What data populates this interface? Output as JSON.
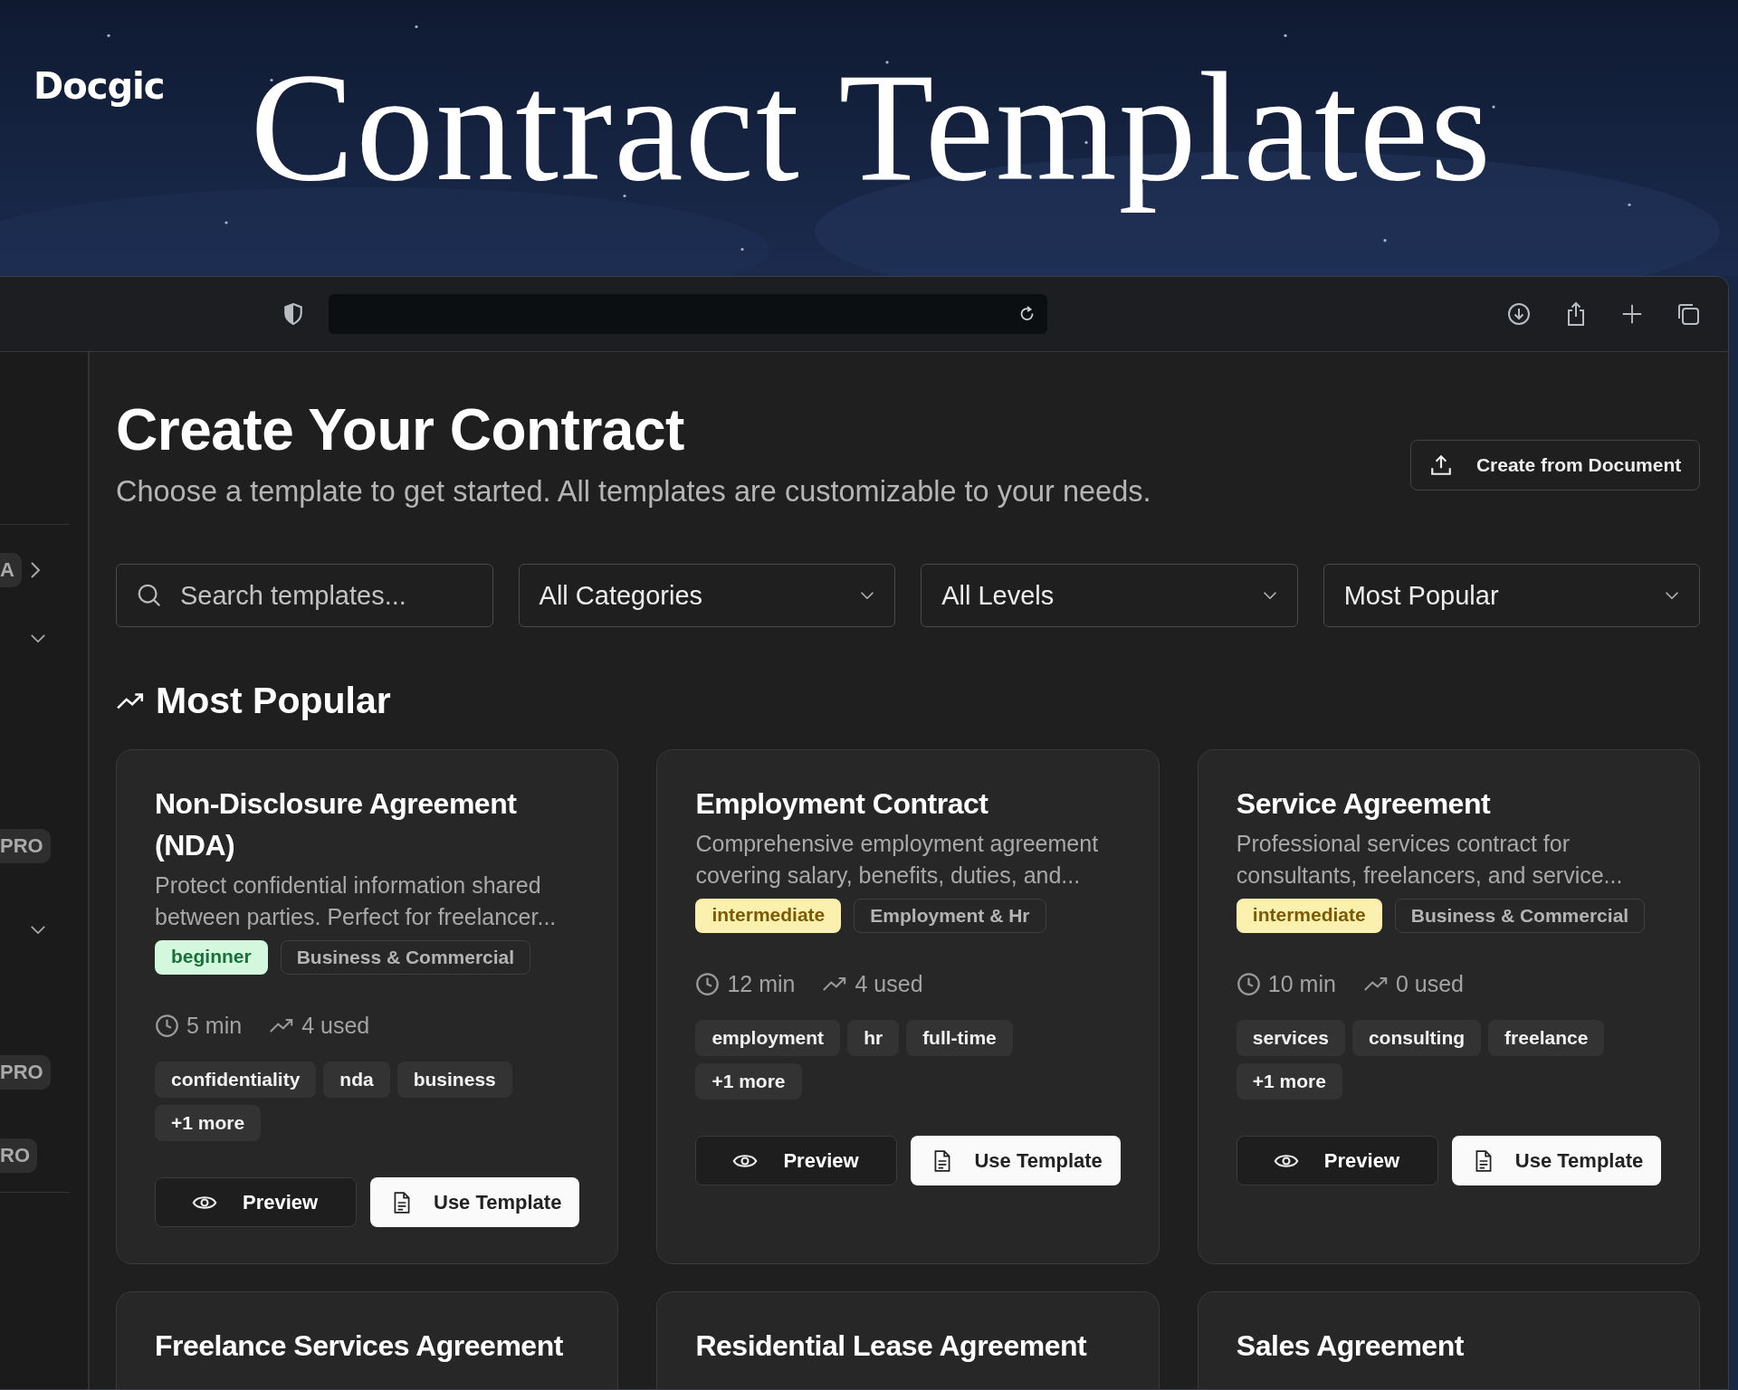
{
  "brand": {
    "logo": "Docgic"
  },
  "hero": {
    "title": "Contract Templates"
  },
  "sidebar": {
    "items": [
      {
        "kind": "badge",
        "text": "A",
        "expanded": false
      },
      {
        "kind": "toggle",
        "expanded": true
      },
      {
        "kind": "badge",
        "text": "PRO"
      },
      {
        "kind": "toggle",
        "expanded": true
      },
      {
        "kind": "badge",
        "text": "PRO"
      },
      {
        "kind": "badge",
        "text": "RO"
      }
    ]
  },
  "page": {
    "title": "Create Your Contract",
    "subtitle": "Choose a template to get started. All templates are customizable to your needs.",
    "action": "Create from Document"
  },
  "filters": {
    "search": {
      "placeholder": "Search templates..."
    },
    "selects": [
      "All Categories",
      "All Levels",
      "Most Popular"
    ]
  },
  "section": {
    "title": "Most Popular"
  },
  "cards": [
    {
      "title": "Non-Disclosure Agreement (NDA)",
      "description": "Protect confidential information shared between parties. Perfect for freelancer...",
      "level": {
        "text": "beginner",
        "kind": "beginner"
      },
      "category": "Business & Commercial",
      "time": "5 min",
      "used": "4 used",
      "tags": [
        "confidentiality",
        "nda",
        "business"
      ],
      "more": "+1 more",
      "preview": "Preview",
      "use": "Use Template"
    },
    {
      "title": "Employment Contract",
      "description": "Comprehensive employment agreement covering salary, benefits, duties, and...",
      "level": {
        "text": "intermediate",
        "kind": "intermediate"
      },
      "category": "Employment & Hr",
      "time": "12 min",
      "used": "4 used",
      "tags": [
        "employment",
        "hr",
        "full-time"
      ],
      "more": "+1 more",
      "preview": "Preview",
      "use": "Use Template"
    },
    {
      "title": "Service Agreement",
      "description": "Professional services contract for consultants, freelancers, and service...",
      "level": {
        "text": "intermediate",
        "kind": "intermediate"
      },
      "category": "Business & Commercial",
      "time": "10 min",
      "used": "0 used",
      "tags": [
        "services",
        "consulting",
        "freelance"
      ],
      "more": "+1 more",
      "preview": "Preview",
      "use": "Use Template"
    },
    {
      "title": "Freelance Services Agreement"
    },
    {
      "title": "Residential Lease Agreement"
    },
    {
      "title": "Sales Agreement"
    }
  ]
}
